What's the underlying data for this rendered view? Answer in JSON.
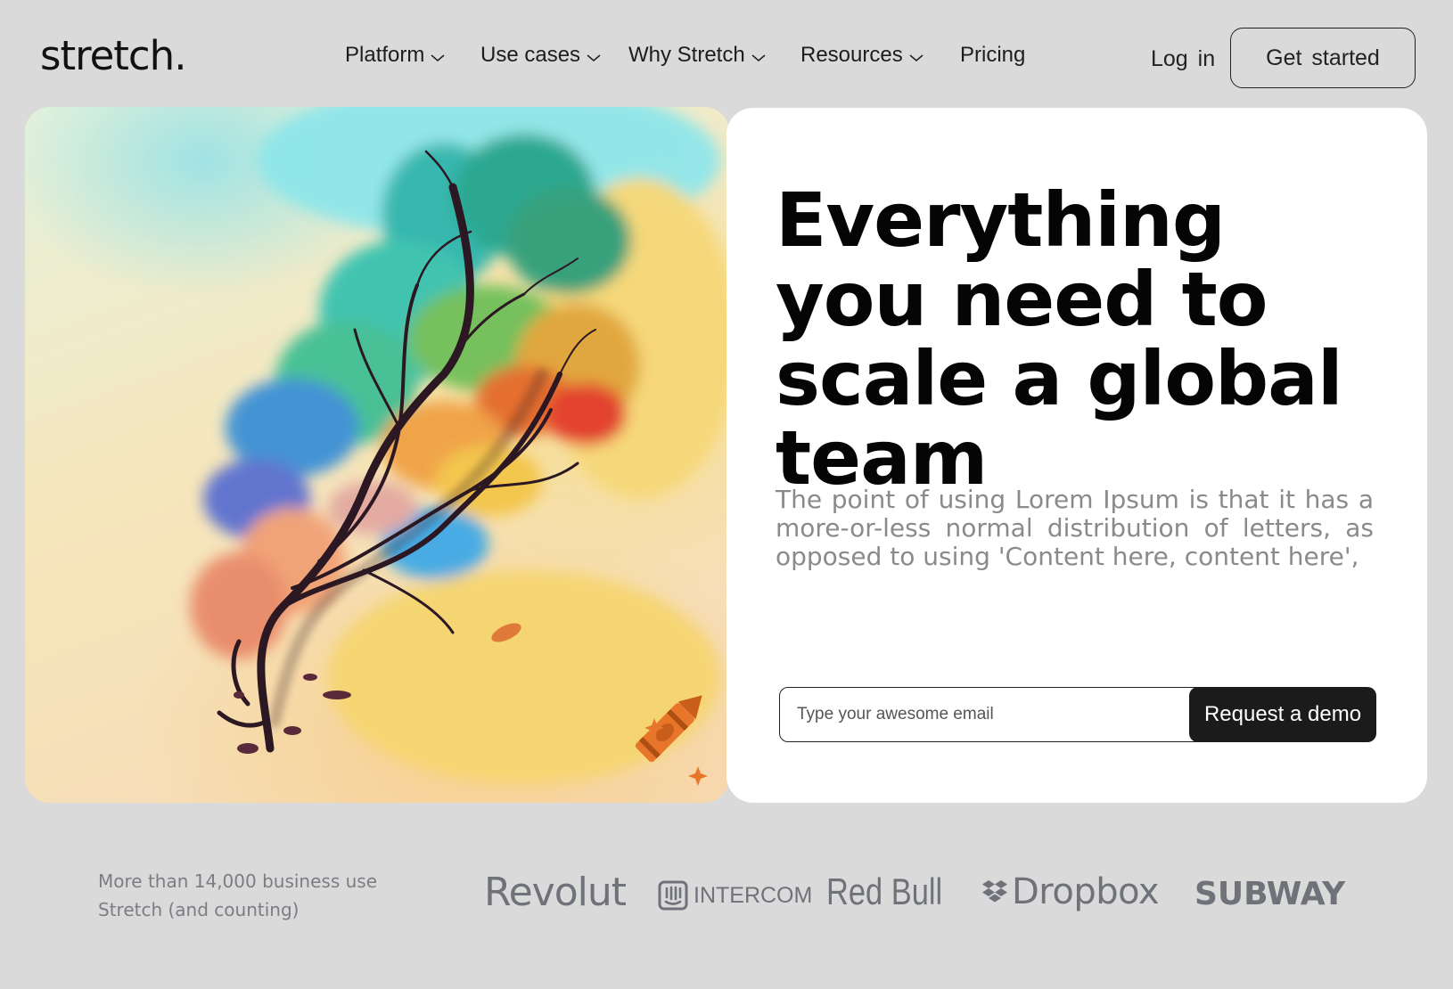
{
  "brand": {
    "logo_text": "stretch."
  },
  "nav": {
    "items": [
      {
        "label": "Platform",
        "has_dropdown": true
      },
      {
        "label": "Use cases",
        "has_dropdown": true
      },
      {
        "label": "Why Stretch",
        "has_dropdown": true
      },
      {
        "label": "Resources",
        "has_dropdown": true
      },
      {
        "label": "Pricing",
        "has_dropdown": false
      }
    ],
    "login_label": "Log  in",
    "get_started_label": "Get  started"
  },
  "hero": {
    "image_icon": "watercolor-tree-illustration",
    "crayon_icon": "crayon-icon",
    "headline": "Everything you need to scale a global team",
    "subcopy": "The point of using Lorem Ipsum is that it has a more-or-less normal distribution of letters, as opposed to using 'Content here, content here',",
    "email_placeholder": "Type your awesome email",
    "email_value": "",
    "demo_button_label": "Request a demo"
  },
  "trust": {
    "text": "More than 14,000 business use\n Stretch (and  counting)",
    "logos": {
      "revolut": "Revolut",
      "intercom": "INTERCOM",
      "redbull": "Red Bull",
      "dropbox": "Dropbox",
      "subway": "SUBWAY"
    }
  },
  "colors": {
    "page_bg": "#dadada",
    "card_bg": "#ffffff",
    "primary_button": "#1b1b1b",
    "subcopy_text": "#8a8a8a",
    "logo_gray": "#70727a",
    "crayon_orange": "#e8762a"
  }
}
